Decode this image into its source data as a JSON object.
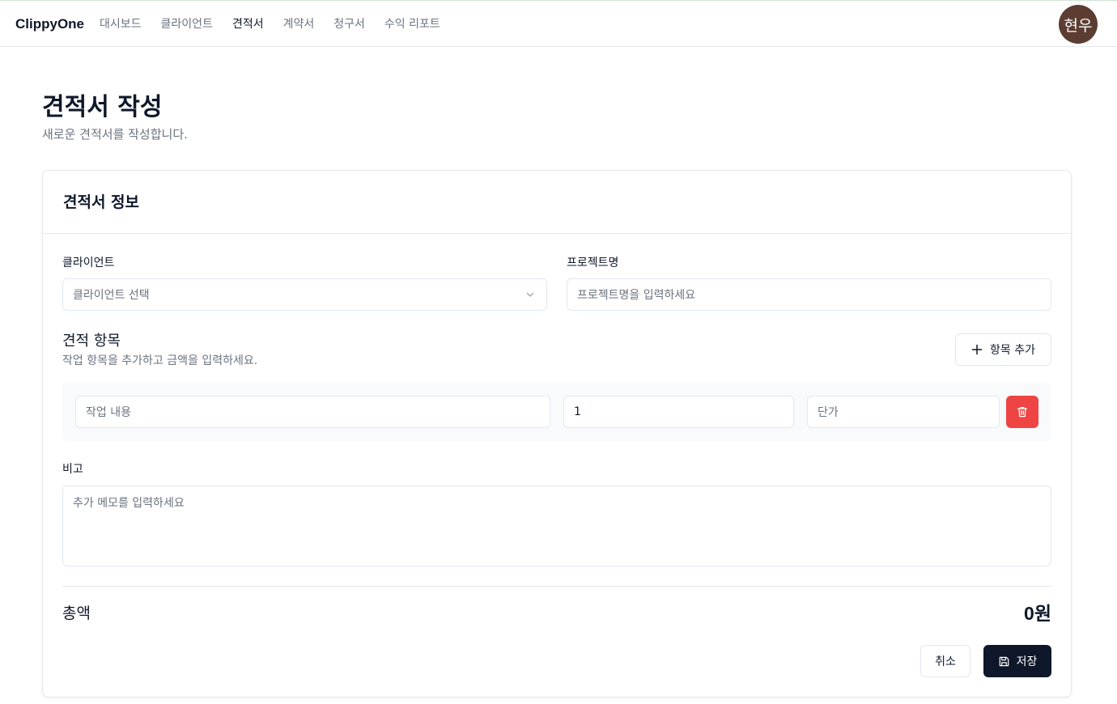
{
  "app": {
    "brand": "ClippyOne",
    "avatar_text": "현우"
  },
  "nav": {
    "items": [
      {
        "label": "대시보드",
        "active": false
      },
      {
        "label": "클라이언트",
        "active": false
      },
      {
        "label": "견적서",
        "active": true
      },
      {
        "label": "계약서",
        "active": false
      },
      {
        "label": "청구서",
        "active": false
      },
      {
        "label": "수익 리포트",
        "active": false
      }
    ]
  },
  "page": {
    "title": "견적서 작성",
    "subtitle": "새로운 견적서를 작성합니다."
  },
  "card": {
    "title": "견적서 정보",
    "client_label": "클라이언트",
    "client_placeholder": "클라이언트 선택",
    "project_label": "프로젝트명",
    "project_placeholder": "프로젝트명을 입력하세요",
    "items_title": "견적 항목",
    "items_subtitle": "작업 항목을 추가하고 금액을 입력하세요.",
    "add_item_label": "항목 추가",
    "item_row": {
      "desc_placeholder": "작업 내용",
      "quantity_value": "1",
      "price_placeholder": "단가"
    },
    "notes_label": "비고",
    "notes_placeholder": "추가 메모를 입력하세요",
    "total_label": "총액",
    "total_value": "0원",
    "cancel_label": "취소",
    "save_label": "저장"
  },
  "colors": {
    "primary_dark": "#0f172a",
    "danger": "#ef4444",
    "avatar_bg": "#5c3d32",
    "muted_text": "#6b7280"
  },
  "icons": [
    "chevron-down-icon",
    "plus-icon",
    "trash-icon",
    "save-icon"
  ]
}
